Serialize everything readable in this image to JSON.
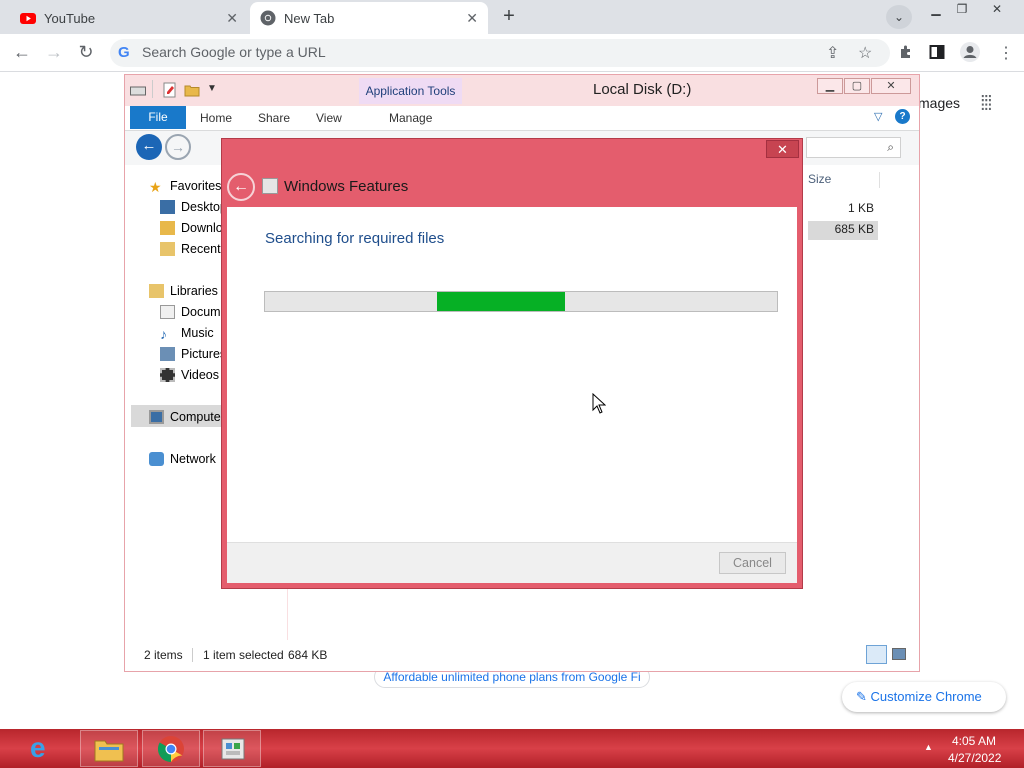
{
  "browser": {
    "tabs": [
      {
        "label": "YouTube",
        "icon": "youtube-icon"
      },
      {
        "label": "New Tab",
        "icon": "chrome-icon"
      }
    ],
    "new_tab_symbol": "+",
    "tab_search_symbol": "⌄",
    "omnibox_placeholder": "Search Google or type a URL",
    "new_tab_page": {
      "images_link": "mages",
      "promo": "Affordable unlimited phone plans from Google Fi",
      "customize_button": "Customize Chrome",
      "customize_icon": "pencil-icon"
    }
  },
  "explorer": {
    "title": "Local Disk (D:)",
    "context_tab": "Application Tools",
    "ribbon_tabs": [
      "File",
      "Home",
      "Share",
      "View",
      "Manage"
    ],
    "nav": {
      "favorites": {
        "label": "Favorites",
        "items": [
          "Desktop",
          "Downlo",
          "Recent"
        ]
      },
      "libraries": {
        "label": "Libraries",
        "items": [
          "Docum",
          "Music",
          "Pictures",
          "Videos"
        ]
      },
      "computer": "Compute",
      "network": "Network"
    },
    "columns": {
      "size": "Size"
    },
    "file_sizes": [
      "1 KB",
      "685 KB"
    ],
    "status": {
      "items": "2 items",
      "selected": "1 item selected",
      "selected_size": "684 KB"
    }
  },
  "dialog": {
    "title": "Windows Features",
    "message": "Searching for required files",
    "progress_fraction": 0.25,
    "cancel_label": "Cancel",
    "close_symbol": "✕"
  },
  "taskbar": {
    "apps": [
      "internet-explorer-icon",
      "file-explorer-icon",
      "chrome-icon",
      "windows-features-icon"
    ],
    "time": "4:05 AM",
    "date": "4/27/2022"
  },
  "colors": {
    "dialog_frame": "#e45d6d",
    "progress": "#06b025",
    "taskbar": "#c8303a",
    "link": "#1a73e8"
  }
}
